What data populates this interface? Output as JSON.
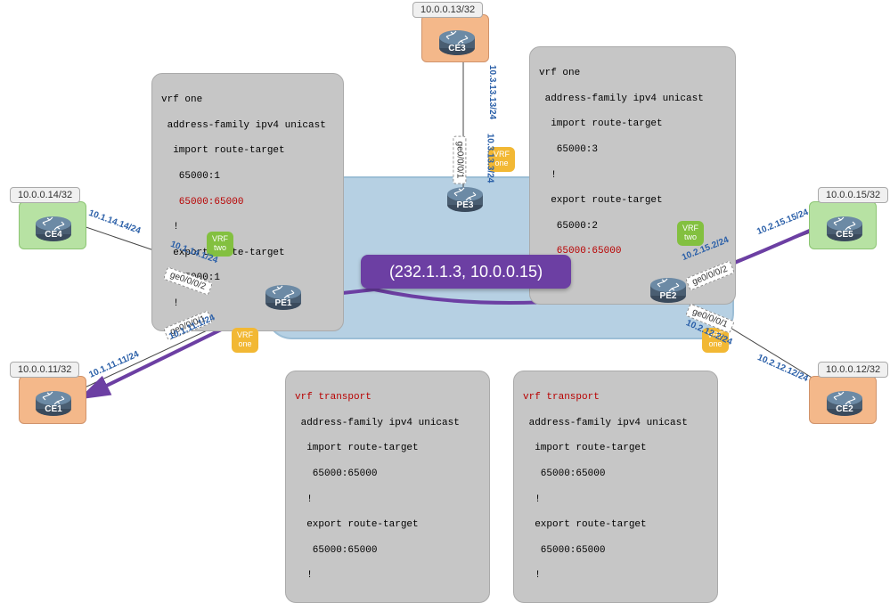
{
  "multicast": "(232.1.1.3, 10.0.0.15)",
  "devices": {
    "ce1": {
      "name": "CE1",
      "loopback": "10.0.0.11/32"
    },
    "ce2": {
      "name": "CE2",
      "loopback": "10.0.0.12/32"
    },
    "ce3": {
      "name": "CE3",
      "loopback": "10.0.0.13/32"
    },
    "ce4": {
      "name": "CE4",
      "loopback": "10.0.0.14/32"
    },
    "ce5": {
      "name": "CE5",
      "loopback": "10.0.0.15/32"
    },
    "pe1": {
      "name": "PE1"
    },
    "pe2": {
      "name": "PE2"
    },
    "pe3": {
      "name": "PE3"
    }
  },
  "vrf_badges": {
    "two": "VRF\ntwo",
    "one": "VRF\none"
  },
  "interfaces": {
    "ge0001": "ge0/0/0/1",
    "ge0002": "ge0/0/0/2"
  },
  "links": {
    "ce4_pe1_ce": "10.1.14.14/24",
    "ce4_pe1_pe": "10.1.14.1/24",
    "ce1_pe1_ce": "10.1.11.11/24",
    "ce1_pe1_pe": "10.1.11.1/24",
    "ce3_pe3_ce": "10.3.13.13/24",
    "ce3_pe3_pe": "10.3.13.3/24",
    "ce5_pe2_ce": "10.2.15.15/24",
    "ce5_pe2_pe": "10.2.15.2/24",
    "ce2_pe2_ce": "10.2.12.12/24",
    "ce2_pe2_pe": "10.2.12.2/24"
  },
  "configs": {
    "pe1_vrfone": {
      "l1": "vrf one",
      "l2": " address-family ipv4 unicast",
      "l3": "  import route-target",
      "l4": "   65000:1",
      "l5": "   65000:65000",
      "l6": "  !",
      "l7": "  export route-target",
      "l8": "   65000:1",
      "l9": "  !"
    },
    "pe3_vrfone": {
      "l1": "vrf one",
      "l2": " address-family ipv4 unicast",
      "l3": "  import route-target",
      "l4": "   65000:3",
      "l5": "  !",
      "l6": "  export route-target",
      "l7": "   65000:2",
      "l8": "   65000:65000",
      "l9": "  !"
    },
    "pe1_transport": {
      "l1": "vrf transport",
      "l2": " address-family ipv4 unicast",
      "l3": "  import route-target",
      "l4": "   65000:65000",
      "l5": "  !",
      "l6": "  export route-target",
      "l7": "   65000:65000",
      "l8": "  !"
    },
    "pe2_transport": {
      "l1": "vrf transport",
      "l2": " address-family ipv4 unicast",
      "l3": "  import route-target",
      "l4": "   65000:65000",
      "l5": "  !",
      "l6": "  export route-target",
      "l7": "   65000:65000",
      "l8": "  !"
    }
  }
}
